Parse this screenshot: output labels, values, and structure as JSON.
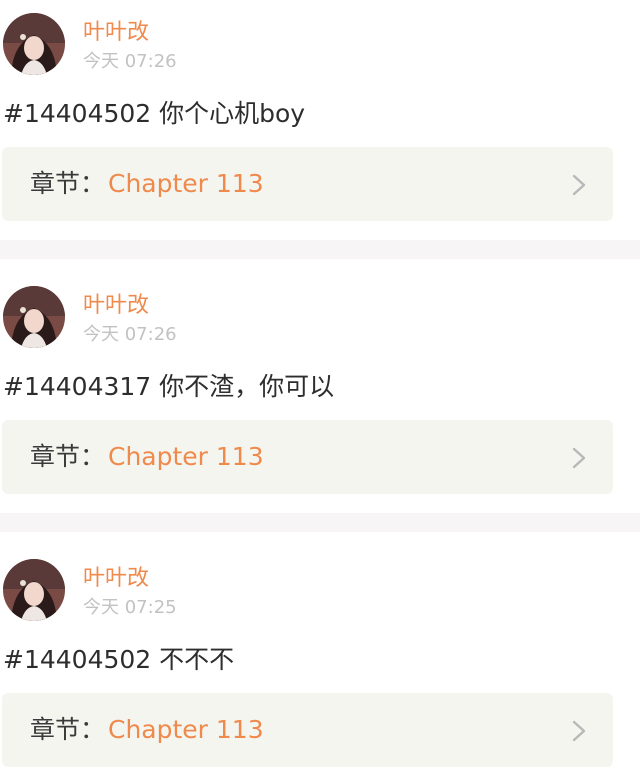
{
  "posts": [
    {
      "username": "叶叶改",
      "time": "今天 07:26",
      "content": "#14404502 你个心机boy",
      "chapter_label": "章节：",
      "chapter_value": "Chapter 113"
    },
    {
      "username": "叶叶改",
      "time": "今天 07:26",
      "content": "#14404317 你不渣，你可以",
      "chapter_label": "章节：",
      "chapter_value": "Chapter 113"
    },
    {
      "username": "叶叶改",
      "time": "今天 07:25",
      "content": "#14404502 不不不",
      "chapter_label": "章节：",
      "chapter_value": "Chapter 113"
    }
  ],
  "icons": {
    "avatar": "avatar-photo",
    "chevron": "chevron-right-icon"
  },
  "colors": {
    "accent": "#ef8a4c",
    "timestamp": "#c2c2c2",
    "card_bg": "#f5f5f0",
    "divider_bg": "#f7f5f5"
  }
}
